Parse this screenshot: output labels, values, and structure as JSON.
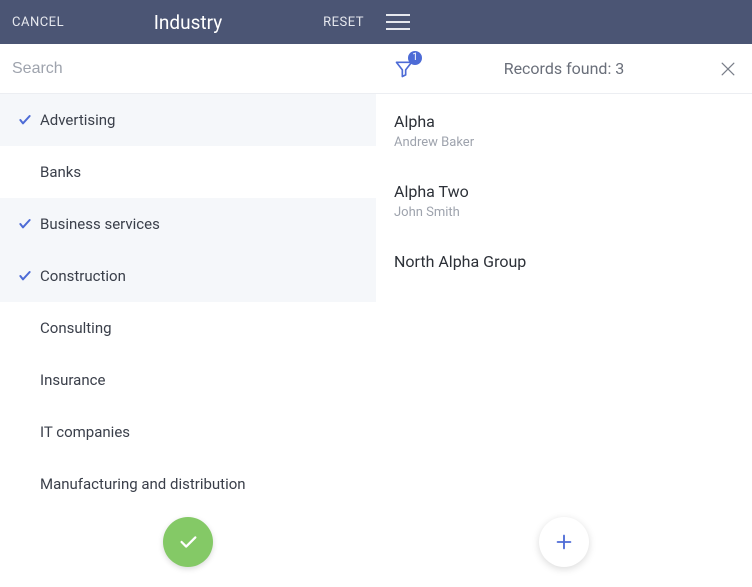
{
  "left": {
    "cancel": "CANCEL",
    "title": "Industry",
    "reset": "RESET",
    "search_placeholder": "Search",
    "items": [
      {
        "label": "Advertising",
        "selected": true
      },
      {
        "label": "Banks",
        "selected": false
      },
      {
        "label": "Business services",
        "selected": true
      },
      {
        "label": "Construction",
        "selected": true
      },
      {
        "label": "Consulting",
        "selected": false
      },
      {
        "label": "Insurance",
        "selected": false
      },
      {
        "label": "IT companies",
        "selected": false
      },
      {
        "label": "Manufacturing and distribution",
        "selected": false
      }
    ]
  },
  "right": {
    "filter_badge": "1",
    "records_text": "Records found: 3",
    "records": [
      {
        "title": "Alpha",
        "subtitle": "Andrew Baker"
      },
      {
        "title": "Alpha Two",
        "subtitle": "John Smith"
      },
      {
        "title": "North Alpha Group",
        "subtitle": ""
      }
    ]
  },
  "colors": {
    "header": "#4b5574",
    "accent": "#4d6bd6",
    "green": "#84c966"
  }
}
